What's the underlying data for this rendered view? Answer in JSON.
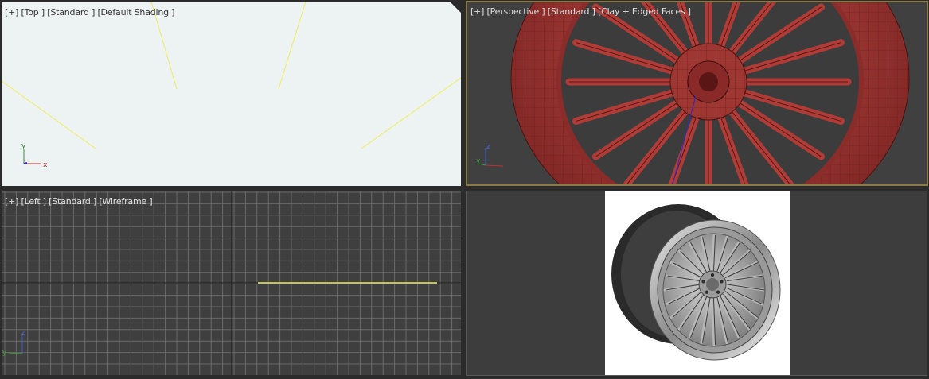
{
  "viewports": {
    "top": {
      "label": "[+] [Top ] [Standard ] [Default Shading ]"
    },
    "perspective": {
      "label": "[+] [Perspective ] [Standard ] [Clay + Edged Faces ]"
    },
    "left": {
      "label": "[+] [Left ] [Standard ] [Wireframe ]"
    },
    "render": {
      "content": "rendered wheel preview"
    }
  },
  "gizmo": {
    "top": {
      "axis_a": "y",
      "axis_b": "x"
    },
    "perspective": {
      "axis_a": "z",
      "axis_b": "y"
    },
    "left": {
      "axis_a": "z",
      "axis_b": "y"
    }
  },
  "colors": {
    "active_border": "#8a7a48",
    "top_bg": "#ecf3f2",
    "viewport_bg": "#404040",
    "light_line": "#f4ef66",
    "wheel_clay": "#a23a38"
  }
}
